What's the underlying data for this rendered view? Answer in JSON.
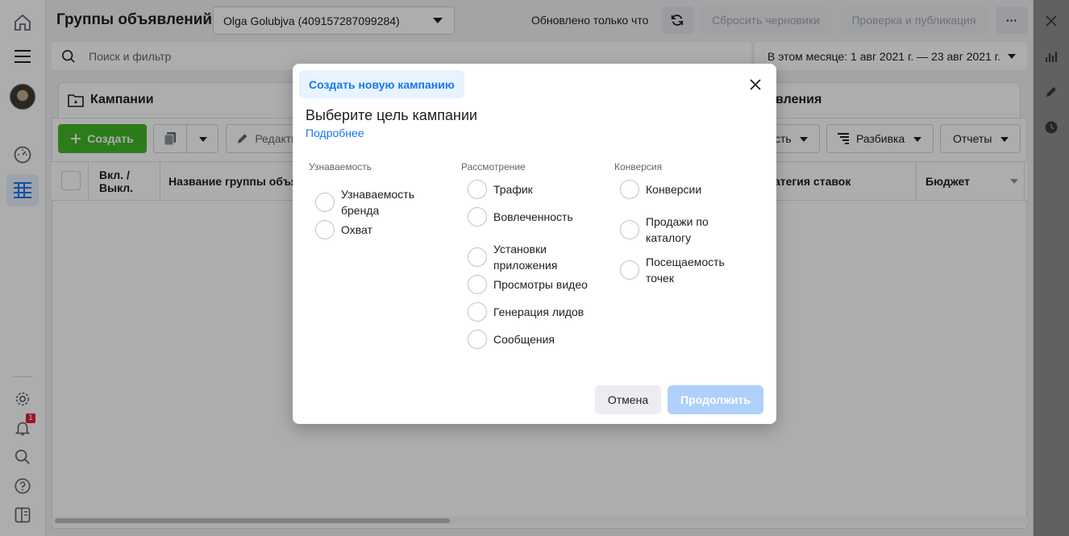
{
  "header": {
    "title": "Группы объявлений",
    "account": "Olga Golubjva (409157287099284)",
    "updated": "Обновлено только что",
    "discard_drafts": "Сбросить черновики",
    "review_publish": "Проверка и публикация",
    "more": "···"
  },
  "search": {
    "placeholder": "Поиск и фильтр",
    "date_range": "В этом месяце: 1 авг 2021 г. — 23 авг 2021 г."
  },
  "tabs": {
    "campaigns": "Кампании",
    "ads_partial": "вления"
  },
  "toolbar": {
    "create": "Создать",
    "edit_partial": "Редакти",
    "settings_partial": "сть",
    "breakdown": "Разбивка",
    "reports": "Отчеты"
  },
  "table": {
    "col_onoff": "Вкл. /\nВыкл.",
    "col_name": "Название группы объя",
    "col_bid": "атегия ставок",
    "col_budget": "Бюджет"
  },
  "leftnav": {
    "notifications_count": "1"
  },
  "modal": {
    "tab": "Создать новую кампанию",
    "heading": "Выберите цель кампании",
    "learn_more": "Подробнее",
    "columns": [
      {
        "title": "Узнаваемость",
        "options": [
          "Узнаваемость бренда",
          "Охват"
        ]
      },
      {
        "title": "Рассмотрение",
        "options": [
          "Трафик",
          "Вовлеченность",
          "Установки приложения",
          "Просмотры видео",
          "Генерация лидов",
          "Сообщения"
        ]
      },
      {
        "title": "Конверсия",
        "options": [
          "Конверсии",
          "Продажи по каталогу",
          "Посещаемость точек"
        ]
      }
    ],
    "cancel": "Отмена",
    "continue": "Продолжить"
  },
  "colors": {
    "accent": "#1877f2",
    "create_green": "#42b72a",
    "continue_disabled": "#aed0fb"
  }
}
